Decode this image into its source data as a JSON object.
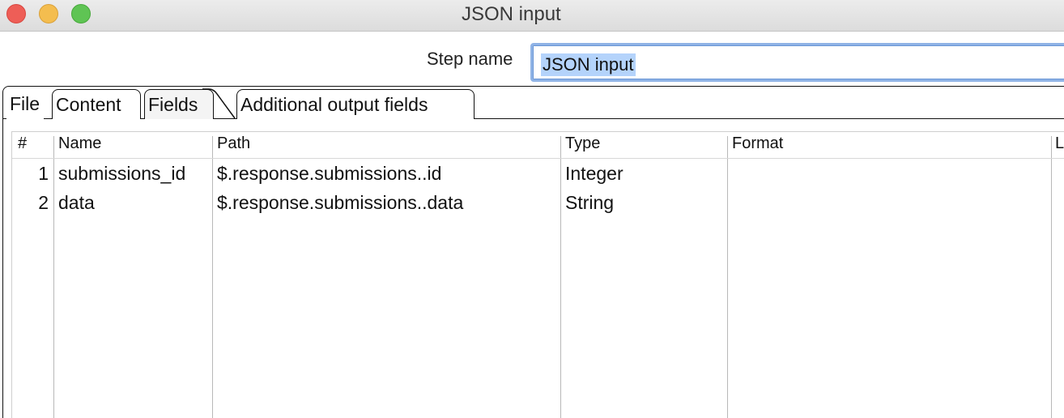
{
  "window": {
    "title": "JSON input"
  },
  "step": {
    "label": "Step name",
    "value": "JSON input"
  },
  "tabs": [
    {
      "label": "File"
    },
    {
      "label": "Content"
    },
    {
      "label": "Fields"
    },
    {
      "label": "Additional output fields"
    }
  ],
  "active_tab": "Fields",
  "table": {
    "columns": [
      "#",
      "Name",
      "Path",
      "Type",
      "Format",
      "L"
    ],
    "rows": [
      {
        "num": "1",
        "name": "submissions_id",
        "path": "$.response.submissions..id",
        "type": "Integer",
        "format": ""
      },
      {
        "num": "2",
        "name": "data",
        "path": "$.response.submissions..data",
        "type": "String",
        "format": ""
      }
    ]
  },
  "colors": {
    "close": "#ee5e57",
    "minimize": "#f4bd4f",
    "maximize": "#5fc454",
    "selection": "#b4d3fb",
    "focus_ring": "#8fb3e6"
  }
}
